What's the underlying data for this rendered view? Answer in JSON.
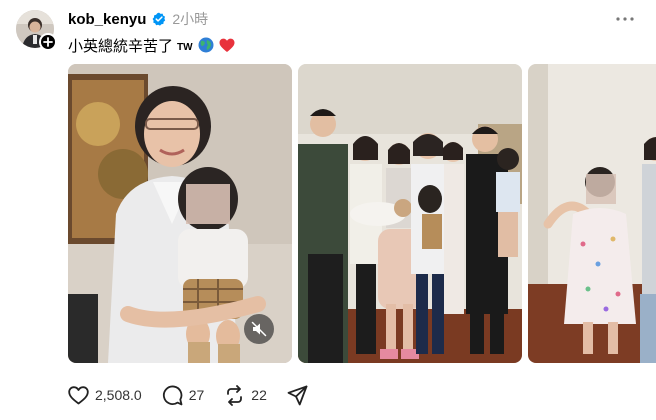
{
  "post": {
    "username": "kob_kenyu",
    "timestamp": "2小時",
    "caption": "小英總統辛苦了",
    "caption_tag": "TW",
    "caption_emojis": [
      "globe-emoji",
      "red-heart-emoji"
    ],
    "media": [
      {
        "name": "photo-1",
        "has_mute_button": true
      },
      {
        "name": "photo-2"
      },
      {
        "name": "photo-3"
      }
    ]
  },
  "actions": {
    "likes": "2,508.0",
    "comments": "27",
    "reposts": "22"
  },
  "icons": {
    "verified": "verified-badge-icon",
    "more": "more-options-icon",
    "follow": "plus-icon",
    "mute": "muted-speaker-icon",
    "like": "heart-icon",
    "comment": "comment-bubble-icon",
    "repost": "repost-icon",
    "share": "share-send-icon"
  },
  "colors": {
    "verified": "#0095f6",
    "timestamp": "#999999",
    "heart_emoji": "#e8323c",
    "globe_emoji": "#1fa58c"
  }
}
